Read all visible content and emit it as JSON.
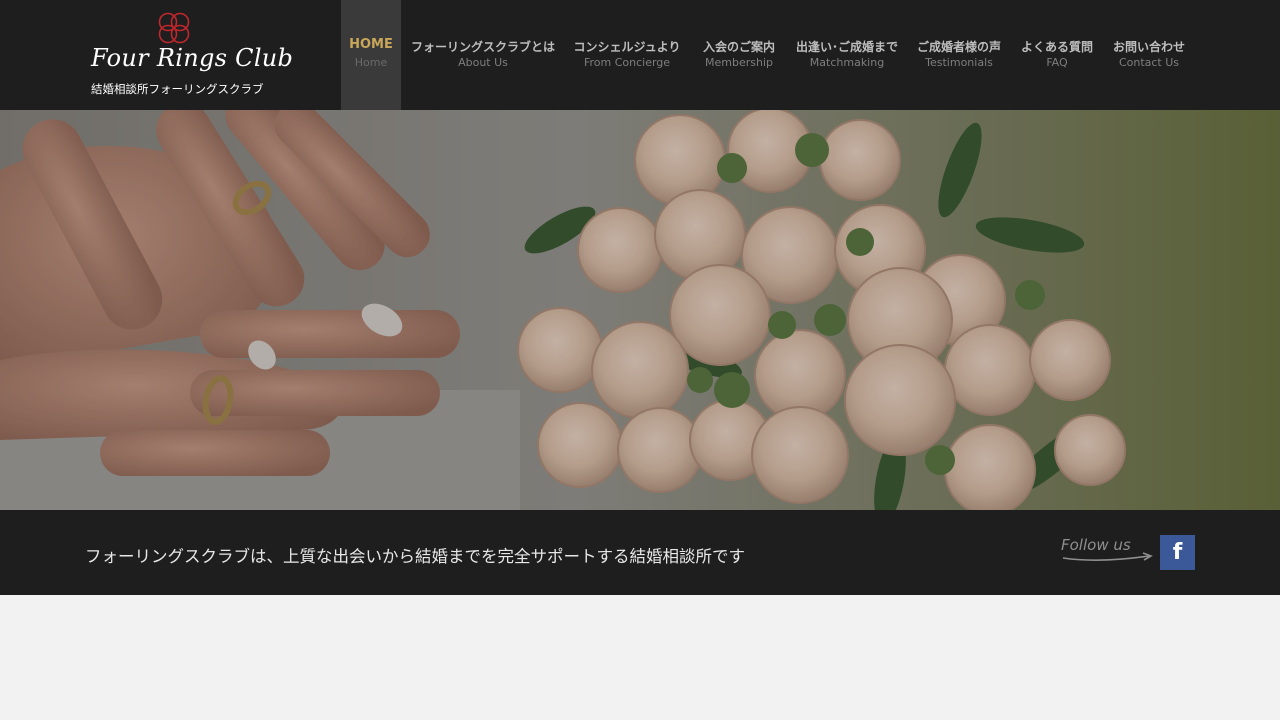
{
  "brand": {
    "title": "Four Rings Club",
    "subtitle": "結婚相談所フォーリングスクラブ",
    "ring_color": "#c0272d"
  },
  "nav": {
    "items": [
      {
        "jp": "HOME",
        "en": "Home",
        "active": true
      },
      {
        "jp": "フォーリングスクラブとは",
        "en": "About Us"
      },
      {
        "jp": "コンシェルジュより",
        "en": "From Concierge"
      },
      {
        "jp": "入会のご案内",
        "en": "Membership"
      },
      {
        "jp": "出逢い･ご成婚まで",
        "en": "Matchmaking"
      },
      {
        "jp": "ご成婚者様の声",
        "en": "Testimonials"
      },
      {
        "jp": "よくある質問",
        "en": "FAQ"
      },
      {
        "jp": "お問い合わせ",
        "en": "Contact Us"
      }
    ],
    "active_color": "#c9a75a"
  },
  "hero": {
    "image": "wedding-hands-rings-and-rose-bouquet-photo"
  },
  "tagline": {
    "text": "フォーリングスクラブは、上質な出会いから結婚までを完全サポートする結婚相談所です"
  },
  "social": {
    "follow_label": "Follow us",
    "facebook_glyph": "f",
    "facebook_icon": "facebook-icon",
    "facebook_color": "#3b5998"
  },
  "colors": {
    "header_bg": "#1e1e1f",
    "page_bg": "#f2f2f2"
  }
}
